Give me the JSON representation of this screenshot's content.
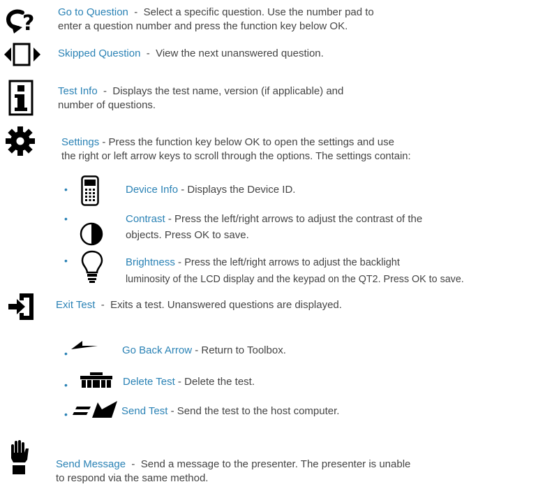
{
  "colors": {
    "term": "#2a82b5",
    "body_text": "#444444",
    "icon": "#000000"
  },
  "items": {
    "go_to_question": {
      "icon": "go-to-question-icon",
      "term": "Go to Question",
      "separator": "  -  ",
      "line1": "Select a specific question. Use the number pad to",
      "line2": "enter a question number and press the function key below OK."
    },
    "skipped_question": {
      "icon": "skipped-question-icon",
      "term": "Skipped Question",
      "separator": "  -  ",
      "line1": "View the next unanswered question."
    },
    "test_info": {
      "icon": "info-icon",
      "term": "Test Info",
      "separator": "  -  ",
      "line1": "Displays the test name, version (if applicable) and",
      "line2": "number of questions."
    },
    "settings": {
      "icon": "gear-icon",
      "term": "Settings",
      "separator": " - ",
      "line1": "Press the function key below OK to open the settings and use",
      "line2": "the right or left arrow keys to scroll through the options. The settings contain:"
    },
    "device_info": {
      "icon": "device-icon",
      "term": "Device Info",
      "separator": " - ",
      "line1": "Displays the Device ID."
    },
    "contrast": {
      "icon": "contrast-icon",
      "term": "Contrast",
      "separator": " - ",
      "line1": "Press the left/right arrows to adjust the contrast of the",
      "line2": "objects. Press OK to save."
    },
    "brightness": {
      "icon": "lightbulb-icon",
      "term": "Brightness",
      "separator": " - ",
      "line1": "Press the left/right arrows to adjust the backlight",
      "line2": "luminosity of the LCD display and the keypad on the QT2.  Press OK to save."
    },
    "exit_test": {
      "icon": "exit-icon",
      "term": "Exit Test",
      "separator": "  -  ",
      "line1": "Exits a test. Unanswered questions are displayed."
    },
    "go_back_arrow": {
      "icon": "back-arrow-icon",
      "term": "Go Back Arrow",
      "separator": " - ",
      "line1": "Return to Toolbox."
    },
    "delete_test": {
      "icon": "delete-icon",
      "term": "Delete Test",
      "separator": " - ",
      "line1": "Delete the test."
    },
    "send_test": {
      "icon": "send-icon",
      "term": "Send Test",
      "separator": " - ",
      "line1": "Send the test to the host computer."
    },
    "send_message": {
      "icon": "raised-hand-icon",
      "term": "Send Message",
      "separator": "  -  ",
      "line1": "Send a message to the presenter. The presenter is unable",
      "line2": "to respond via the same method."
    }
  },
  "bullet_char": "•"
}
